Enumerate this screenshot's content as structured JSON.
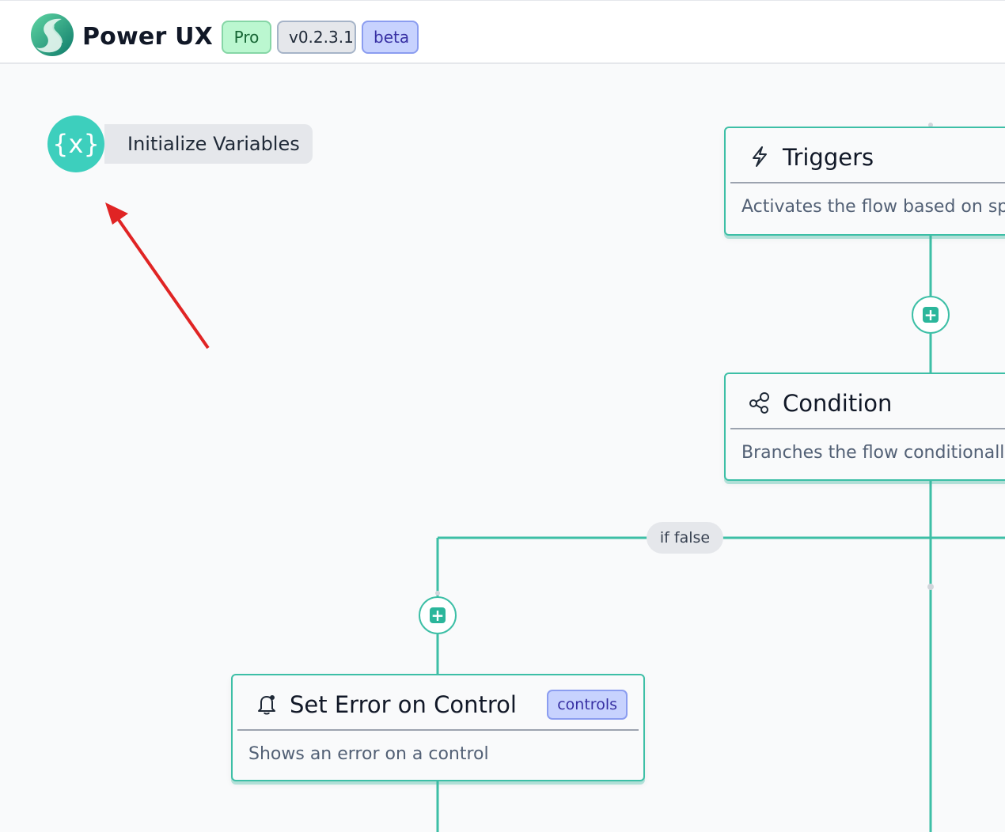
{
  "header": {
    "app_name": "Power UX",
    "badges": {
      "plan": "Pro",
      "version": "v0.2.3.1",
      "stage": "beta"
    }
  },
  "canvas": {
    "variables_node": {
      "icon": "{x}",
      "label": "Initialize Variables"
    },
    "nodes": {
      "triggers": {
        "icon": "lightning-icon",
        "title": "Triggers",
        "description": "Activates the flow based on spec"
      },
      "condition": {
        "icon": "branch-icon",
        "title": "Condition",
        "description": "Branches the flow conditionally"
      },
      "set_error": {
        "icon": "bell-icon",
        "title": "Set Error on Control",
        "description": "Shows an error on a control",
        "tag": "controls"
      }
    },
    "edge_label": "if false",
    "add_button_symbol": "+"
  },
  "colors": {
    "accent": "#3dbfa6",
    "variable": "#3dcfbd",
    "annotation_arrow": "#e02424"
  }
}
